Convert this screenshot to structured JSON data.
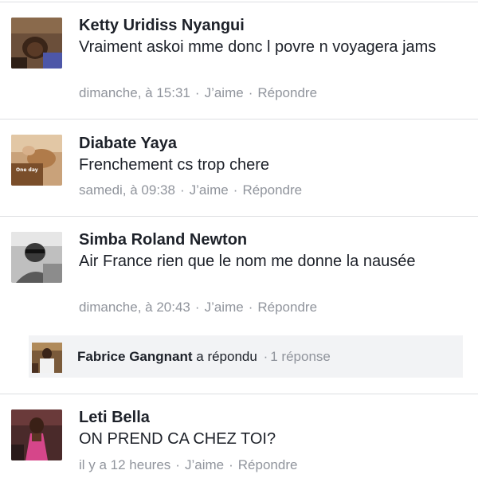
{
  "comments": [
    {
      "name": "Ketty Uridiss Nyangui",
      "text": "Vraiment askoi mme donc l povre n voyagera jams",
      "time": "dimanche, à 15:31",
      "like": "J’aime",
      "reply": "Répondre"
    },
    {
      "name": "Diabate Yaya",
      "text": "Frenchement cs trop chere",
      "time": "samedi, à 09:38",
      "like": "J’aime",
      "reply": "Répondre",
      "avatar_caption": "One day"
    },
    {
      "name": "Simba Roland Newton",
      "text": "Air France rien que le nom me donne la nausée",
      "time": "dimanche, à 20:43",
      "like": "J’aime",
      "reply": "Répondre"
    },
    {
      "name": "Leti Bella",
      "text": "ON PREND CA CHEZ TOI?",
      "time": "il y a 12 heures",
      "like": "J’aime",
      "reply": "Répondre"
    }
  ],
  "reply_summary": {
    "name": "Fabrice Gangnant",
    "action": "a répondu",
    "separator": "·",
    "count": "1 réponse"
  },
  "colors": {
    "text": "#1d2129",
    "meta": "#90949c",
    "divider": "#dddfe2",
    "reply_bg": "#f2f3f5"
  }
}
